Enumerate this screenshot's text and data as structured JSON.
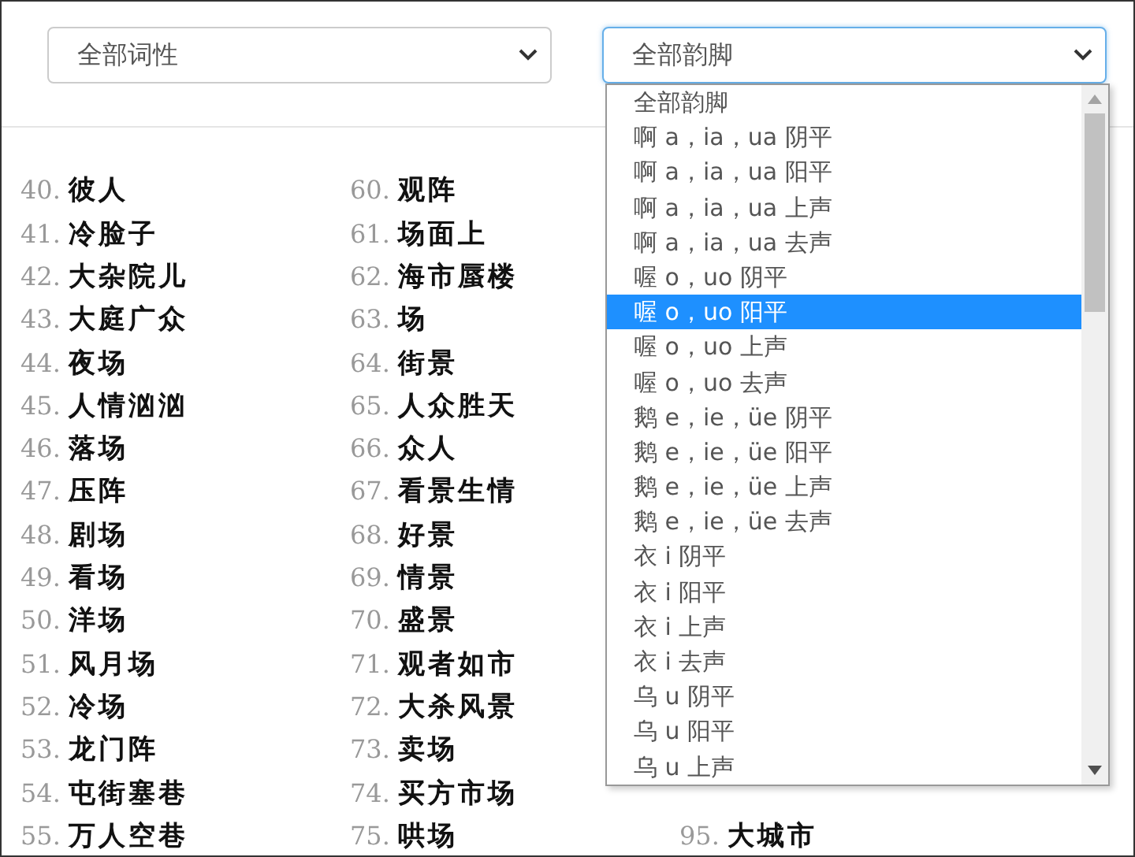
{
  "filters": [
    {
      "value": "全部词性",
      "focused": false
    },
    {
      "value": "全部韵脚",
      "focused": true
    }
  ],
  "dropdown": {
    "options": [
      {
        "label": "全部韵脚",
        "selected": false
      },
      {
        "label": "啊 a，ia，ua 阴平",
        "selected": false
      },
      {
        "label": "啊 a，ia，ua 阳平",
        "selected": false
      },
      {
        "label": "啊 a，ia，ua 上声",
        "selected": false
      },
      {
        "label": "啊 a，ia，ua 去声",
        "selected": false
      },
      {
        "label": "喔 o，uo 阴平",
        "selected": false
      },
      {
        "label": "喔 o，uo 阳平",
        "selected": true
      },
      {
        "label": "喔 o，uo 上声",
        "selected": false
      },
      {
        "label": "喔 o，uo 去声",
        "selected": false
      },
      {
        "label": "鹅 e，ie，üe 阴平",
        "selected": false
      },
      {
        "label": "鹅 e，ie，üe 阳平",
        "selected": false
      },
      {
        "label": "鹅 e，ie，üe 上声",
        "selected": false
      },
      {
        "label": "鹅 e，ie，üe 去声",
        "selected": false
      },
      {
        "label": "衣 i 阴平",
        "selected": false
      },
      {
        "label": "衣 i 阳平",
        "selected": false
      },
      {
        "label": "衣 i 上声",
        "selected": false
      },
      {
        "label": "衣 i 去声",
        "selected": false
      },
      {
        "label": "乌 u 阴平",
        "selected": false
      },
      {
        "label": "乌 u 阳平",
        "selected": false
      },
      {
        "label": "乌 u 上声",
        "selected": false
      }
    ]
  },
  "columns": [
    [
      {
        "num": "40.",
        "word": "彼人"
      },
      {
        "num": "41.",
        "word": "冷脸子"
      },
      {
        "num": "42.",
        "word": "大杂院儿"
      },
      {
        "num": "43.",
        "word": "大庭广众"
      },
      {
        "num": "44.",
        "word": "夜场"
      },
      {
        "num": "45.",
        "word": "人情汹汹"
      },
      {
        "num": "46.",
        "word": "落场"
      },
      {
        "num": "47.",
        "word": "压阵"
      },
      {
        "num": "48.",
        "word": "剧场"
      },
      {
        "num": "49.",
        "word": "看场"
      },
      {
        "num": "50.",
        "word": "洋场"
      },
      {
        "num": "51.",
        "word": "风月场"
      },
      {
        "num": "52.",
        "word": "冷场"
      },
      {
        "num": "53.",
        "word": "龙门阵"
      },
      {
        "num": "54.",
        "word": "屯街塞巷"
      },
      {
        "num": "55.",
        "word": "万人空巷"
      }
    ],
    [
      {
        "num": "60.",
        "word": "观阵"
      },
      {
        "num": "61.",
        "word": "场面上"
      },
      {
        "num": "62.",
        "word": "海市蜃楼"
      },
      {
        "num": "63.",
        "word": "场"
      },
      {
        "num": "64.",
        "word": "街景"
      },
      {
        "num": "65.",
        "word": "人众胜天"
      },
      {
        "num": "66.",
        "word": "众人"
      },
      {
        "num": "67.",
        "word": "看景生情"
      },
      {
        "num": "68.",
        "word": "好景"
      },
      {
        "num": "69.",
        "word": "情景"
      },
      {
        "num": "70.",
        "word": "盛景"
      },
      {
        "num": "71.",
        "word": "观者如市"
      },
      {
        "num": "72.",
        "word": "大杀风景"
      },
      {
        "num": "73.",
        "word": "卖场"
      },
      {
        "num": "74.",
        "word": "买方市场"
      },
      {
        "num": "75.",
        "word": "哄场"
      }
    ],
    [
      {
        "num": "95.",
        "word": "大城市"
      }
    ]
  ]
}
